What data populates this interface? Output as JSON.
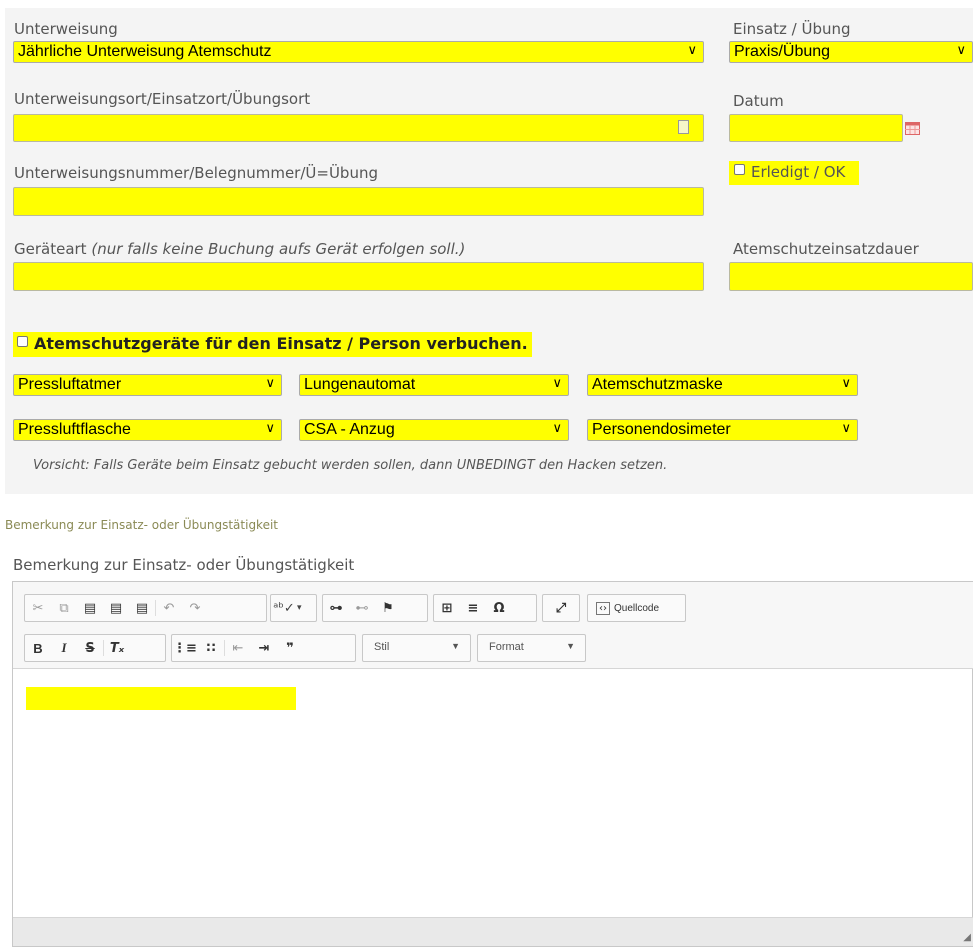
{
  "form": {
    "unterweisung": {
      "label": "Unterweisung",
      "value": "Jährliche Unterweisung Atemschutz"
    },
    "einsatz": {
      "label": "Einsatz / Übung",
      "value": "Praxis/Übung"
    },
    "ort": {
      "label": "Unterweisungsort/Einsatzort/Übungsort",
      "value": ""
    },
    "datum": {
      "label": "Datum",
      "value": ""
    },
    "nummer": {
      "label": "Unterweisungsnummer/Belegnummer/Ü=Übung",
      "value": ""
    },
    "erledigt": {
      "label": "Erledigt / OK",
      "checked": false
    },
    "geraeteart": {
      "label": "Geräteart",
      "hint": "(nur falls keine Buchung aufs Gerät erfolgen soll.)",
      "value": ""
    },
    "dauer": {
      "label": "Atemschutzeinsatzdauer",
      "value": ""
    },
    "verbuchen": {
      "label": "Atemschutzgeräte für den Einsatz / Person verbuchen.",
      "checked": false
    },
    "devices": [
      "Pressluftatmer",
      "Lungenautomat",
      "Atemschutzmaske",
      "Pressluftflasche",
      "CSA - Anzug",
      "Personendosimeter"
    ],
    "warning": "Vorsicht: Falls Geräte beim Einsatz gebucht werden sollen, dann UNBEDINGT den Hacken setzen."
  },
  "remarks": {
    "section_title": "Bemerkung zur Einsatz- oder Übungstätigkeit",
    "field_label": "Bemerkung zur Einsatz- oder Übungstätigkeit",
    "toolbar": {
      "source_label": "Quellcode",
      "style_label": "Stil",
      "format_label": "Format"
    },
    "content": ""
  },
  "colors": {
    "highlight": "#ffff00",
    "panel": "#f4f4f4",
    "section_title": "#8a8a55"
  }
}
